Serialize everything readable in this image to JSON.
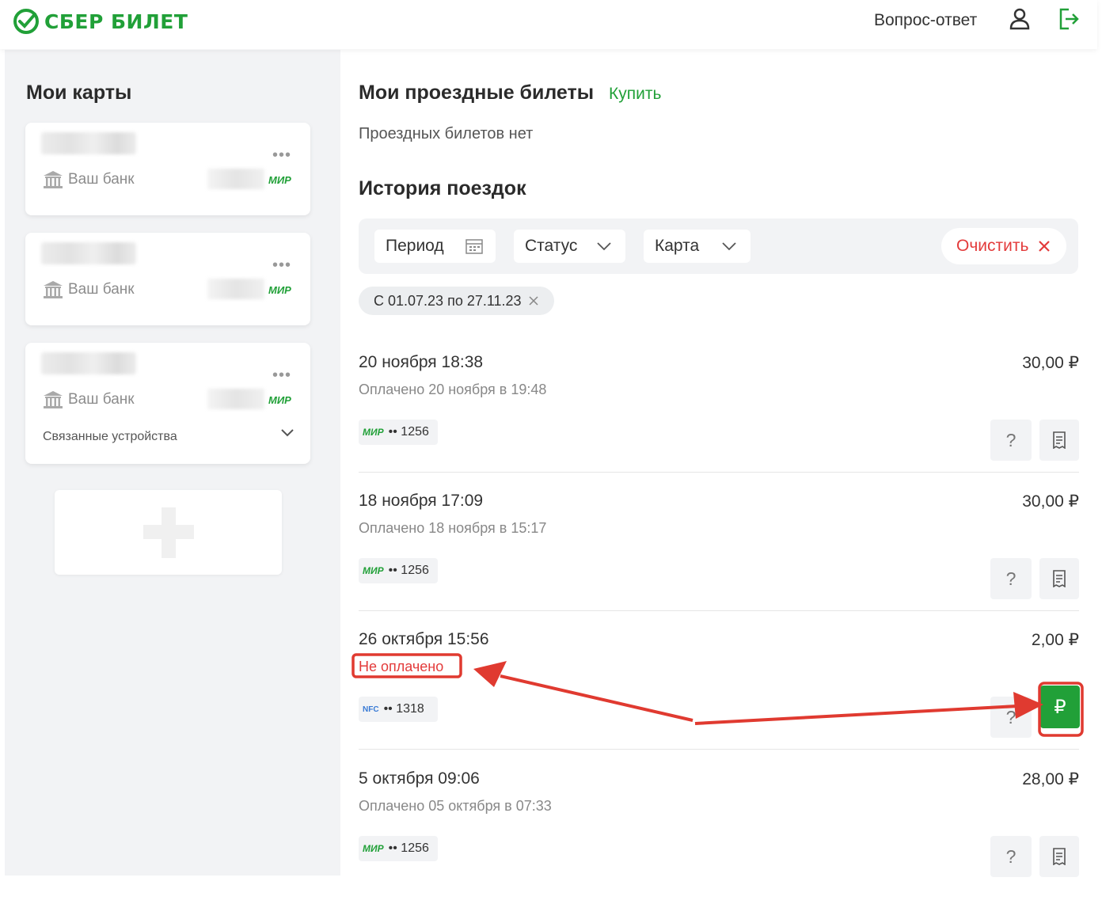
{
  "header": {
    "logo_text": "СБЕР БИЛЕТ",
    "faq_label": "Вопрос-ответ",
    "icons": [
      "sber-check-icon",
      "user-icon",
      "logout-icon"
    ]
  },
  "sidebar": {
    "title": "Мои карты",
    "cards": [
      {
        "bank_label": "Ваш банк",
        "brand": "МИР"
      },
      {
        "bank_label": "Ваш банк",
        "brand": "МИР"
      },
      {
        "bank_label": "Ваш банк",
        "brand": "МИР",
        "devices_label": "Связанные устройства"
      }
    ]
  },
  "tickets": {
    "title": "Мои проездные билеты",
    "buy_label": "Купить",
    "empty_text": "Проездных билетов нет"
  },
  "history": {
    "title": "История поездок",
    "filters": {
      "period_label": "Период",
      "status_label": "Статус",
      "card_label": "Карта",
      "clear_label": "Очистить"
    },
    "chip_text": "С 01.07.23 по 27.11.23",
    "trips": [
      {
        "date": "20 ноября 18:38",
        "amount": "30,00 ₽",
        "status": "Оплачено 20 ноября в 19:48",
        "brand": "МИР",
        "pan": "•• 1256",
        "help": "?"
      },
      {
        "date": "18 ноября 17:09",
        "amount": "30,00 ₽",
        "status": "Оплачено 18 ноября в 15:17",
        "brand": "МИР",
        "pan": "•• 1256",
        "help": "?"
      },
      {
        "date": "26 октября 15:56",
        "amount": "2,00 ₽",
        "status": "Не оплачено",
        "brand": "NFC",
        "pan": "•• 1318",
        "help": "?",
        "pay_label": "₽"
      },
      {
        "date": "5 октября 09:06",
        "amount": "28,00 ₽",
        "status": "Оплачено 05 октября в 07:33",
        "brand": "МИР",
        "pan": "•• 1256",
        "help": "?"
      }
    ]
  },
  "colors": {
    "brand_green": "#21a038",
    "alert_red": "#e33b3b",
    "panel_gray": "#f2f3f5"
  }
}
